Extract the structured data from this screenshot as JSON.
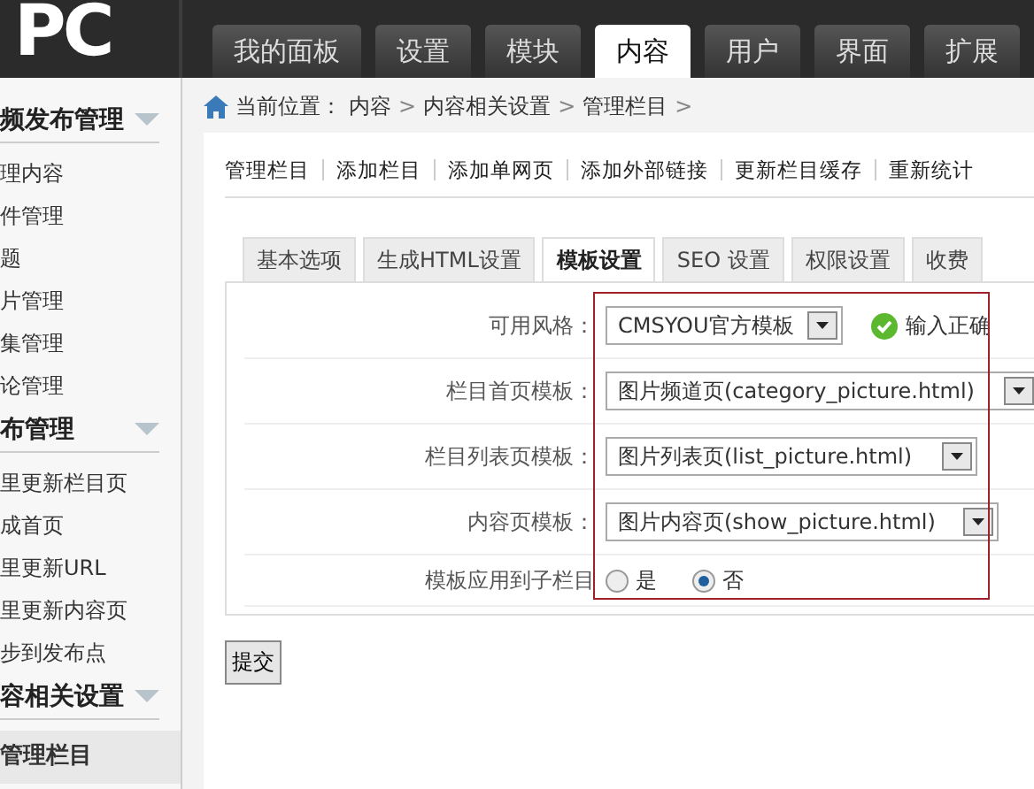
{
  "header": {
    "logo": "PC",
    "tabs": [
      {
        "label": "我的面板",
        "selected": false
      },
      {
        "label": "设置",
        "selected": false
      },
      {
        "label": "模块",
        "selected": false
      },
      {
        "label": "内容",
        "selected": true
      },
      {
        "label": "用户",
        "selected": false
      },
      {
        "label": "界面",
        "selected": false
      },
      {
        "label": "扩展",
        "selected": false
      }
    ]
  },
  "sidebar": {
    "groups": [
      {
        "title": "频发布管理",
        "expanded": true,
        "items": [
          {
            "label": "理内容",
            "selected": false
          },
          {
            "label": "件管理",
            "selected": false
          },
          {
            "label": "题",
            "selected": false
          },
          {
            "label": "片管理",
            "selected": false
          },
          {
            "label": "集管理",
            "selected": false
          },
          {
            "label": "论管理",
            "selected": false
          }
        ]
      },
      {
        "title": "布管理",
        "expanded": true,
        "items": [
          {
            "label": "里更新栏目页",
            "selected": false
          },
          {
            "label": "成首页",
            "selected": false
          },
          {
            "label": "里更新URL",
            "selected": false
          },
          {
            "label": "里更新内容页",
            "selected": false
          },
          {
            "label": "步到发布点",
            "selected": false
          }
        ]
      },
      {
        "title": "容相关设置",
        "expanded": true,
        "items": [
          {
            "label": "管理栏目",
            "selected": true
          }
        ]
      }
    ]
  },
  "breadcrumb": {
    "label": "当前位置：",
    "path": [
      "内容",
      "内容相关设置",
      "管理栏目"
    ],
    "separator": ">"
  },
  "submenu": [
    "管理栏目",
    "添加栏目",
    "添加单网页",
    "添加外部链接",
    "更新栏目缓存",
    "重新统计"
  ],
  "tabs": [
    {
      "label": "基本选项",
      "selected": false
    },
    {
      "label": "生成HTML设置",
      "selected": false
    },
    {
      "label": "模板设置",
      "selected": true
    },
    {
      "label": "SEO 设置",
      "selected": false
    },
    {
      "label": "权限设置",
      "selected": false
    },
    {
      "label": "收费",
      "selected": false
    }
  ],
  "form": [
    {
      "kind": "select",
      "label": "可用风格：",
      "value": "CMSYOU官方模板",
      "status": "输入正确"
    },
    {
      "kind": "select",
      "label": "栏目首页模板：",
      "value": "图片频道页(category_picture.html)"
    },
    {
      "kind": "select",
      "label": "栏目列表页模板：",
      "value": "图片列表页(list_picture.html)"
    },
    {
      "kind": "select",
      "label": "内容页模板：",
      "value": "图片内容页(show_picture.html)"
    },
    {
      "kind": "radio",
      "label": "模板应用到子栏目",
      "options": [
        {
          "label": "是",
          "selected": false
        },
        {
          "label": "否",
          "selected": true
        }
      ]
    }
  ],
  "submit": "提交"
}
